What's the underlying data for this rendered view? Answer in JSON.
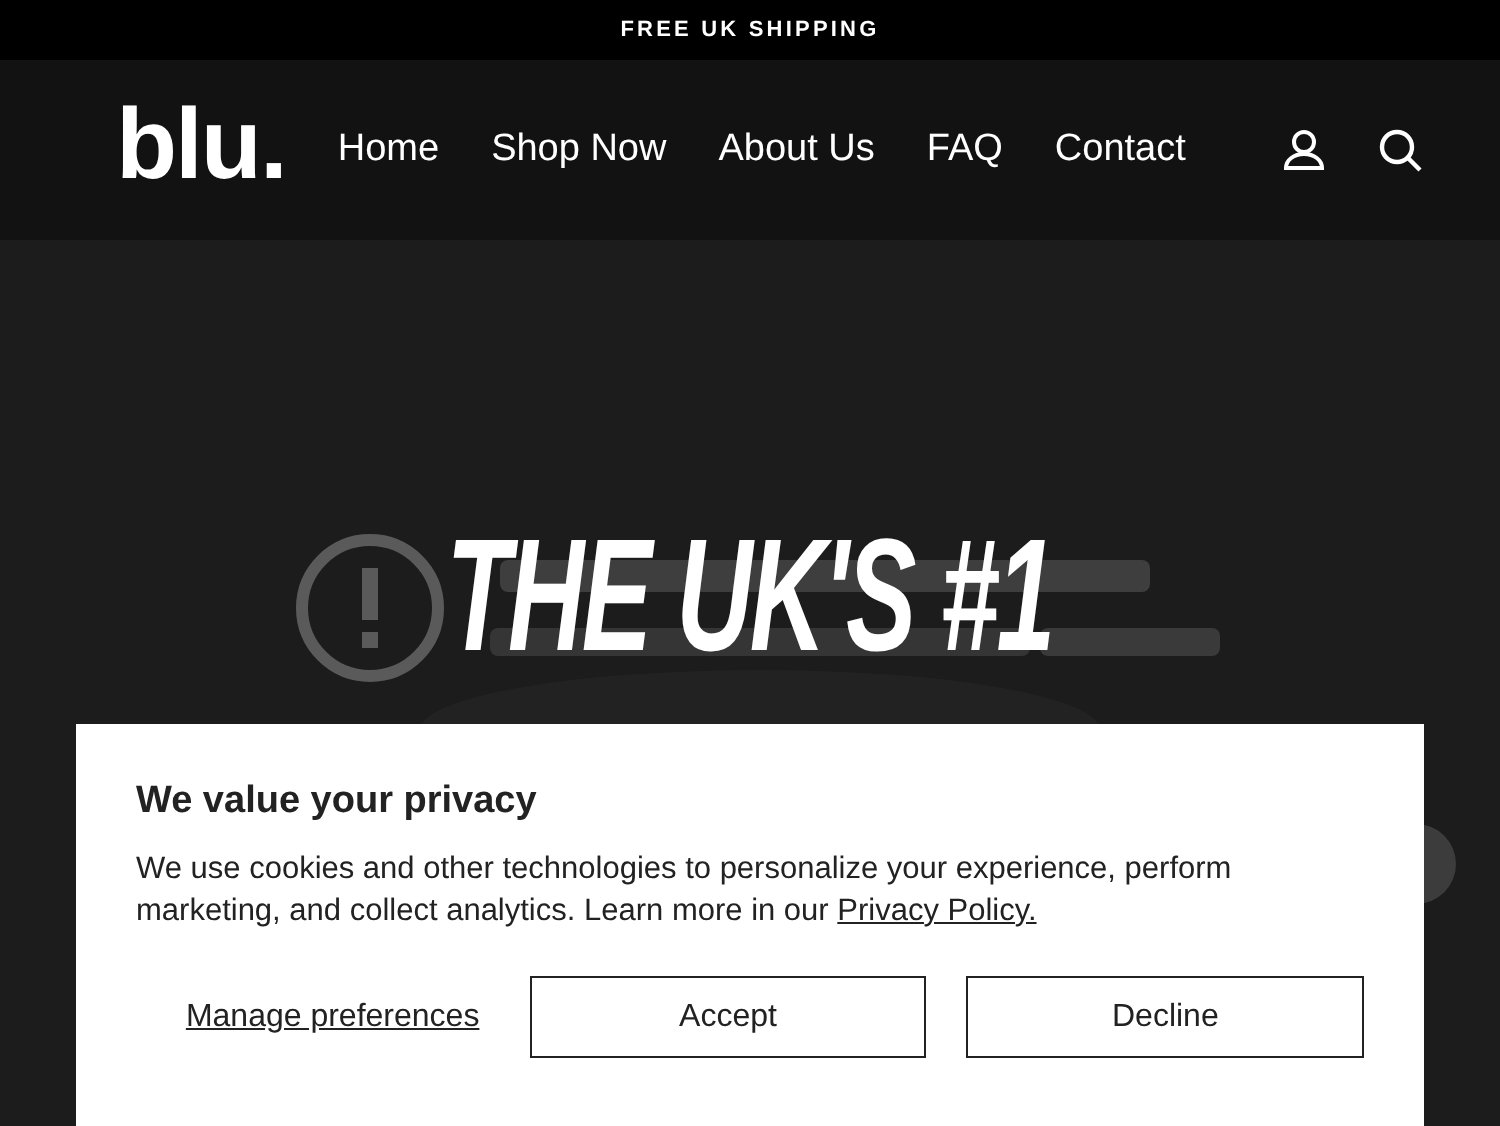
{
  "announcement": "FREE UK SHIPPING",
  "header": {
    "logo": "blu.",
    "nav": [
      "Home",
      "Shop Now",
      "About Us",
      "FAQ",
      "Contact"
    ]
  },
  "hero": {
    "video": {
      "kind": "picture"
    },
    "headline": [
      "THE UK'S #1"
    ]
  },
  "cookie_banner": {
    "title": "We value your privacy",
    "text": "We use cookies and other technologies to personalize your experience, perform marketing, and collect analytics. Learn more in our ",
    "link": "Privacy Policy.",
    "manage": "Manage preferences",
    "buttons": [
      "Accept",
      "Decline"
    ]
  }
}
